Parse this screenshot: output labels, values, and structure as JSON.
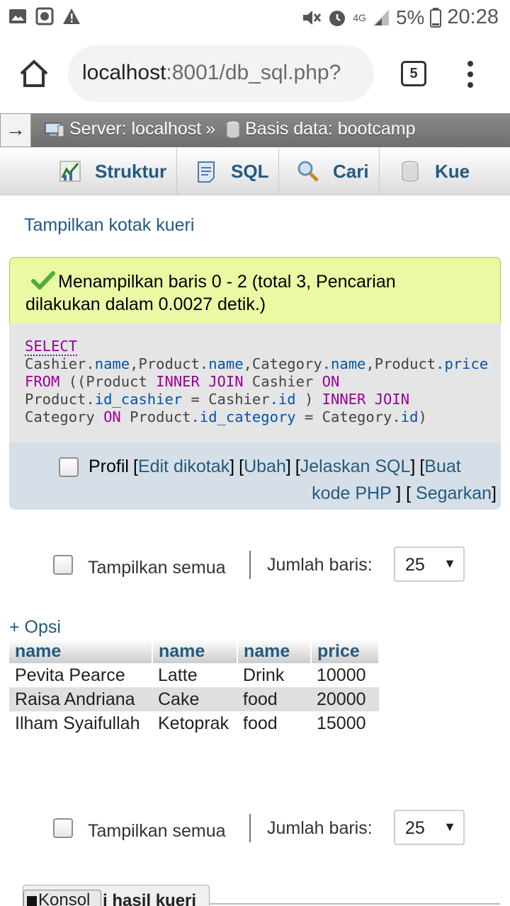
{
  "status_bar": {
    "left_icons": [
      "image-icon",
      "media-icon",
      "warning-icon"
    ],
    "network": "4G",
    "battery": "5%",
    "time": "20:28"
  },
  "browser": {
    "url_host": "localhost",
    "url_rest": ":8001/db_sql.php?",
    "tab_count": "5"
  },
  "breadcrumb": {
    "server": "Server: localhost",
    "separator": "»",
    "database": "Basis data: bootcamp"
  },
  "tabs": [
    {
      "label": "Struktur",
      "icon": "structure-icon"
    },
    {
      "label": "SQL",
      "icon": "sql-icon"
    },
    {
      "label": "Cari",
      "icon": "search-icon"
    },
    {
      "label": "Kue",
      "icon": "query-icon"
    }
  ],
  "query_box_toggle": "Tampilkan kotak kueri",
  "success_message": "Menampilkan baris 0 - 2 (total 3, Pencarian dilakukan dalam 0.0027 detik.)",
  "sql": {
    "line1": "SELECT",
    "line2_a": "Cashier",
    "line2_b": ".name",
    "line2_c": ",Product",
    "line2_d": ".name",
    "line2_e": ",Category",
    "line2_f": ".name",
    "line2_g": ",Product",
    "line2_h": ".price",
    "line3_a": "FROM",
    "line3_b": " ((Product ",
    "line3_c": "INNER JOIN",
    "line3_d": " Cashier ",
    "line3_e": "ON",
    "line4_a": "Product",
    "line4_b": ".id_cashier",
    "line4_c": " = Cashier",
    "line4_d": ".id",
    "line4_e": " ) ",
    "line4_f": "INNER JOIN",
    "line5_a": "Category ",
    "line5_b": "ON",
    "line5_c": " Product",
    "line5_d": ".id_category",
    "line5_e": " = Category",
    "line5_f": ".id",
    "line5_g": ")"
  },
  "profil": {
    "label": "Profil",
    "edit_inline": "Edit dikotak",
    "edit": "Ubah",
    "explain": "Jelaskan SQL",
    "create_php_1": "Buat",
    "create_php_2": "kode PHP",
    "refresh": "Segarkan"
  },
  "navigation": {
    "show_all": "Tampilkan semua",
    "rows_label": "Jumlah baris:",
    "rows_value": "25"
  },
  "options_link": "+ Opsi",
  "table": {
    "headers": [
      "name",
      "name",
      "name",
      "price"
    ],
    "rows": [
      [
        "Pevita Pearce",
        "Latte",
        "Drink",
        "10000"
      ],
      [
        "Raisa Andriana",
        "Cake",
        "food",
        "20000"
      ],
      [
        "Ilham Syaifullah",
        "Ketoprak",
        "food",
        "15000"
      ]
    ]
  },
  "console": {
    "label": "Konsol",
    "text": "i hasil kueri"
  }
}
